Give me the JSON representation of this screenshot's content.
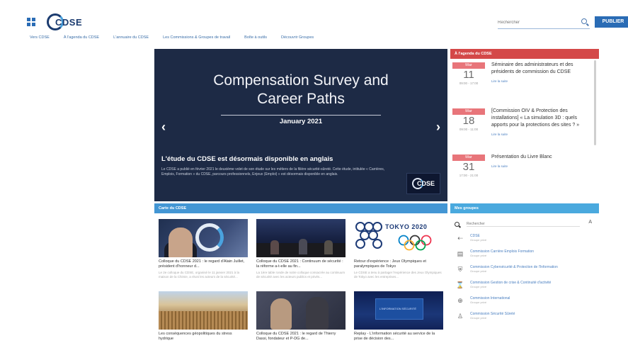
{
  "header": {
    "logo_text": "CDSE",
    "logo_tagline": "",
    "search_placeholder": "Rechercher",
    "publish_label": "PUBLIER",
    "nav": [
      "Vers CDSE",
      "À l'agenda du CDSE",
      "L'annuaire du CDSE",
      "Les Commissions & Groupes de travail",
      "Boîte à outils",
      "Découvrir Groupes"
    ]
  },
  "hero": {
    "title_line1": "Compensation Survey and",
    "title_line2": "Career Paths",
    "date": "January 2021",
    "headline": "L'étude du CDSE est désormais disponible en anglais",
    "description": "Le CDSE a publié en février 2021 le deuxième volet de son étude sur les métiers de la filière sécurité-sûreté. Cette étude, intitulée « Carrières, Emplois, Formation » du CDSE, parcours professionnels, Enjeux (Emploi) » est désormais disponible en anglais.",
    "logo_text": "CDSE"
  },
  "agenda": {
    "header": "À l'agenda du CDSE",
    "events": [
      {
        "month": "Mar",
        "day": "11",
        "time": "09:00 - 17:00",
        "title": "Séminaire des administrateurs et des présidents de commission du CDSE",
        "more": "Lire la suite"
      },
      {
        "month": "Mar",
        "day": "18",
        "time": "09:00 - 11:00",
        "title": "[Commission OIV & Protection des installations] « La simulation 3D : quels apports pour la protections des sites ? »",
        "more": "Lire la suite"
      },
      {
        "month": "Mar",
        "day": "31",
        "time": "17:00 - 21:00",
        "title": "Présentation du Livre Blanc",
        "more": "Lire la suite"
      }
    ]
  },
  "news": {
    "header": "Carte du CDSE",
    "cards": [
      {
        "title": "Colloque du CDSE 2021 : le regard d'Alain Juillet, président d'honneur d...",
        "excerpt": "Le 2e colloque du CDSE, organisé le 11 janvier 2021 à la maison de la Chimie, a réuni les acteurs de la sécurité..."
      },
      {
        "title": "Colloque du CDSE 2021 : Continuum de sécurité : la réforme a-t-elle au fin...",
        "excerpt": "La 1ère table ronde de notre colloque consacrée au continuum de sécurité avec les acteurs publics et privés..."
      },
      {
        "title": "Retour d'expérience : Jeux Olympiques et paralympiques de Tokyo",
        "excerpt": "Le CDSE a tenu à partager l'expérience des Jeux Olympiques de Tokyo avec les entreprises..."
      },
      {
        "title": "Les conséquences géopolitiques du stress hydrique",
        "excerpt": ""
      },
      {
        "title": "Colloque du CDSE 2021 : le regard de Thierry Dassi, fondateur et P-DG de...",
        "excerpt": ""
      },
      {
        "title": "Replay - L'information sécurité au service de la prise de décision des...",
        "excerpt": ""
      }
    ],
    "img3_title": "TOKYO 2020",
    "img6_text": "L'INFORMATION SÉCURITÉ"
  },
  "groups": {
    "header": "Mes groupes",
    "search_placeholder": "Rechercher",
    "sort_label": "A",
    "items": [
      {
        "icon": "arrow-left-icon",
        "glyph": "⇠",
        "name": "CDSE",
        "type": "Groupe privé"
      },
      {
        "icon": "book-icon",
        "glyph": "▤",
        "name": "Commission Carrière Emplois Formation",
        "type": "Groupe privé"
      },
      {
        "icon": "shield-icon",
        "glyph": "⛨",
        "name": "Commission Cybersécurité & Protection de l'Information",
        "type": "Groupe privé"
      },
      {
        "icon": "continuity-icon",
        "glyph": "⌛",
        "name": "Commission Gestion de crise & Continuité d'activité",
        "type": "Groupe privé"
      },
      {
        "icon": "globe-icon",
        "glyph": "⊕",
        "name": "Commission International",
        "type": "Groupe privé"
      },
      {
        "icon": "person-icon",
        "glyph": "♙",
        "name": "Commission Sécurité Sûreté",
        "type": "Groupe privé"
      }
    ]
  }
}
